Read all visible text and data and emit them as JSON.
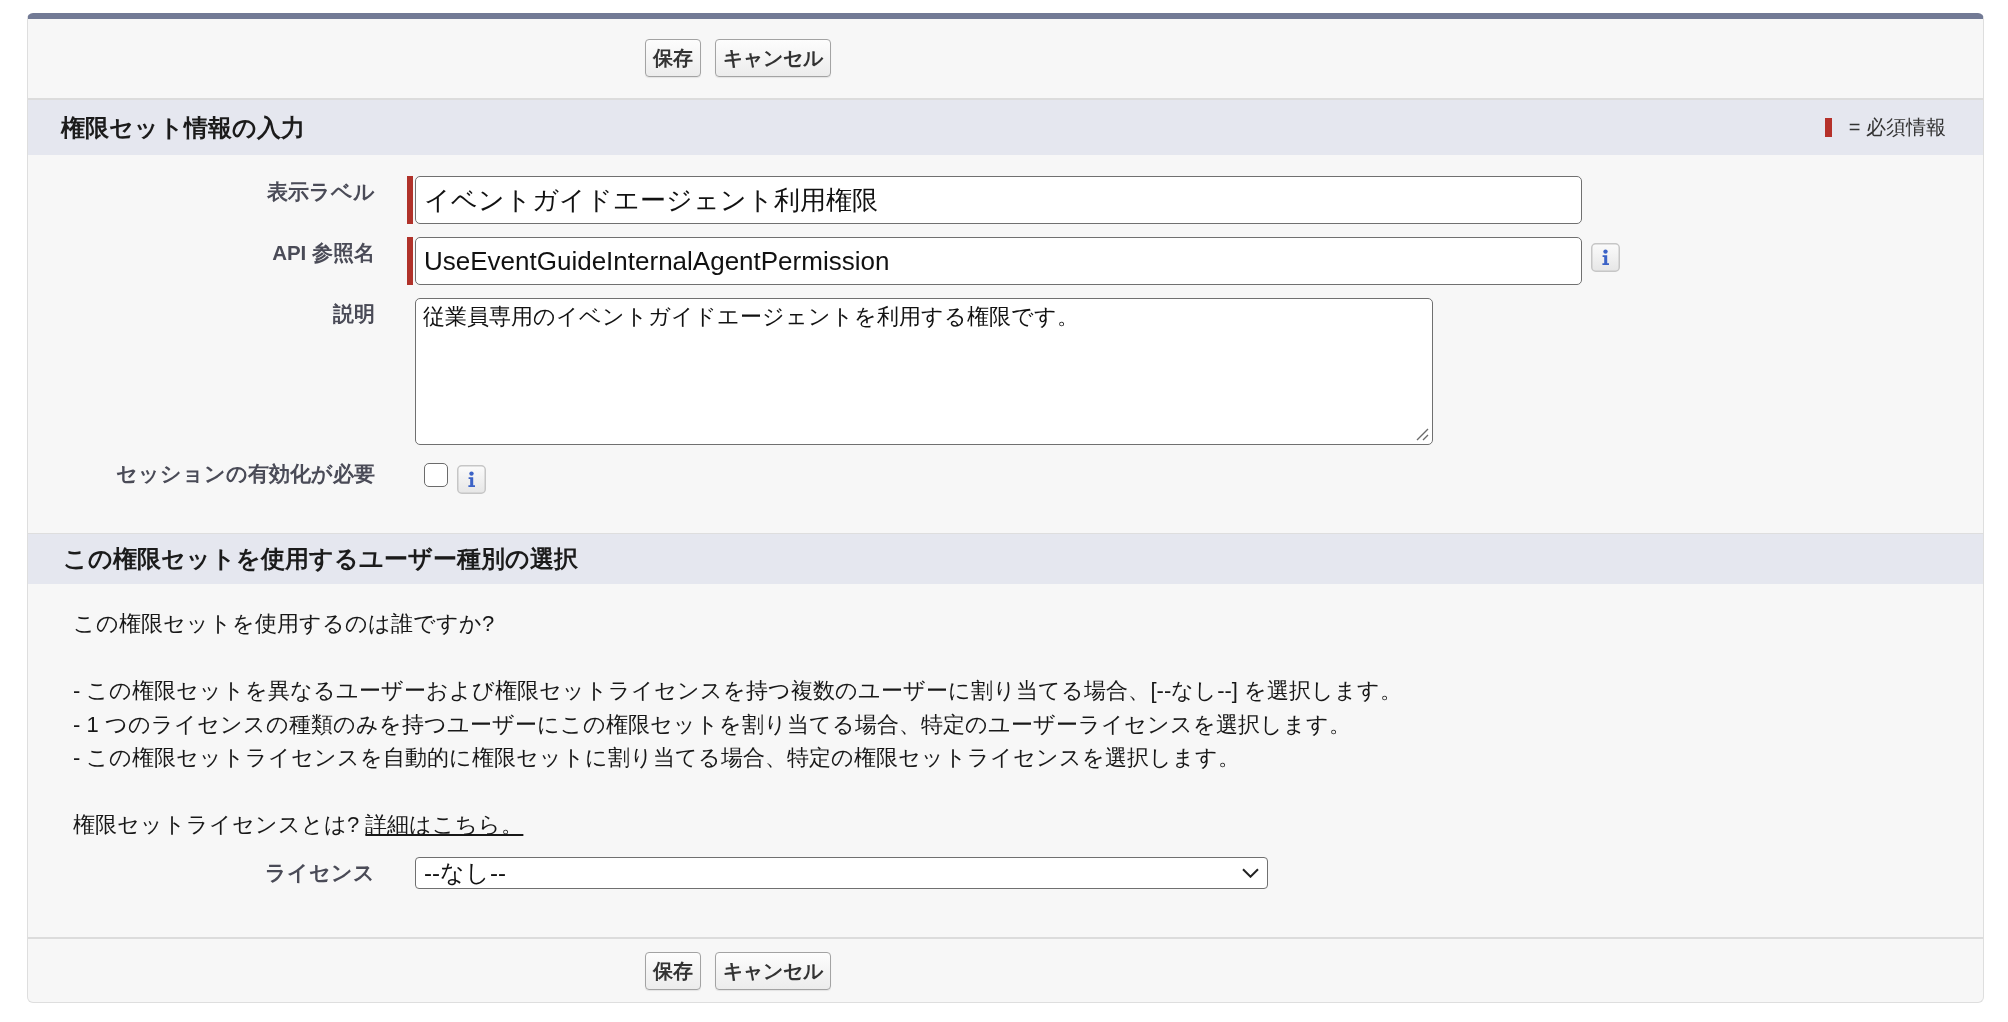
{
  "top_buttons": [
    "保存",
    "キャンセル"
  ],
  "info_section": {
    "title": "権限セット情報の入力",
    "required_legend": "= 必須情報",
    "fields": [
      {
        "kind": "text",
        "label": "表示ラベル",
        "value": "イベントガイドエージェント利用権限",
        "required": true,
        "help": false
      },
      {
        "kind": "text",
        "label": "API 参照名",
        "value": "UseEventGuideInternalAgentPermission",
        "required": true,
        "help": true
      },
      {
        "kind": "textarea",
        "label": "説明",
        "value": "従業員専用のイベントガイドエージェントを利用する権限です。",
        "required": false,
        "help": false
      },
      {
        "kind": "checkbox",
        "label": "セッションの有効化が必要",
        "checked": false,
        "required": false,
        "help": true
      }
    ]
  },
  "license_section": {
    "title": "この権限セットを使用するユーザー種別の選択",
    "question": "この権限セットを使用するのは誰ですか?",
    "instructions": [
      "- この権限セットを異なるユーザーおよび権限セットライセンスを持つ複数のユーザーに割り当てる場合、[--なし--] を選択します。",
      "- 1 つのライセンスの種類のみを持つユーザーにこの権限セットを割り当てる場合、特定のユーザーライセンスを選択します。",
      "- この権限セットライセンスを自動的に権限セットに割り当てる場合、特定の権限セットライセンスを選択します。"
    ],
    "note": "権限セットライセンスとは?",
    "link": "詳細はこちら。",
    "license": {
      "label": "ライセンス",
      "value": "--なし--"
    }
  },
  "bottom_buttons": [
    "保存",
    "キャンセル"
  ]
}
